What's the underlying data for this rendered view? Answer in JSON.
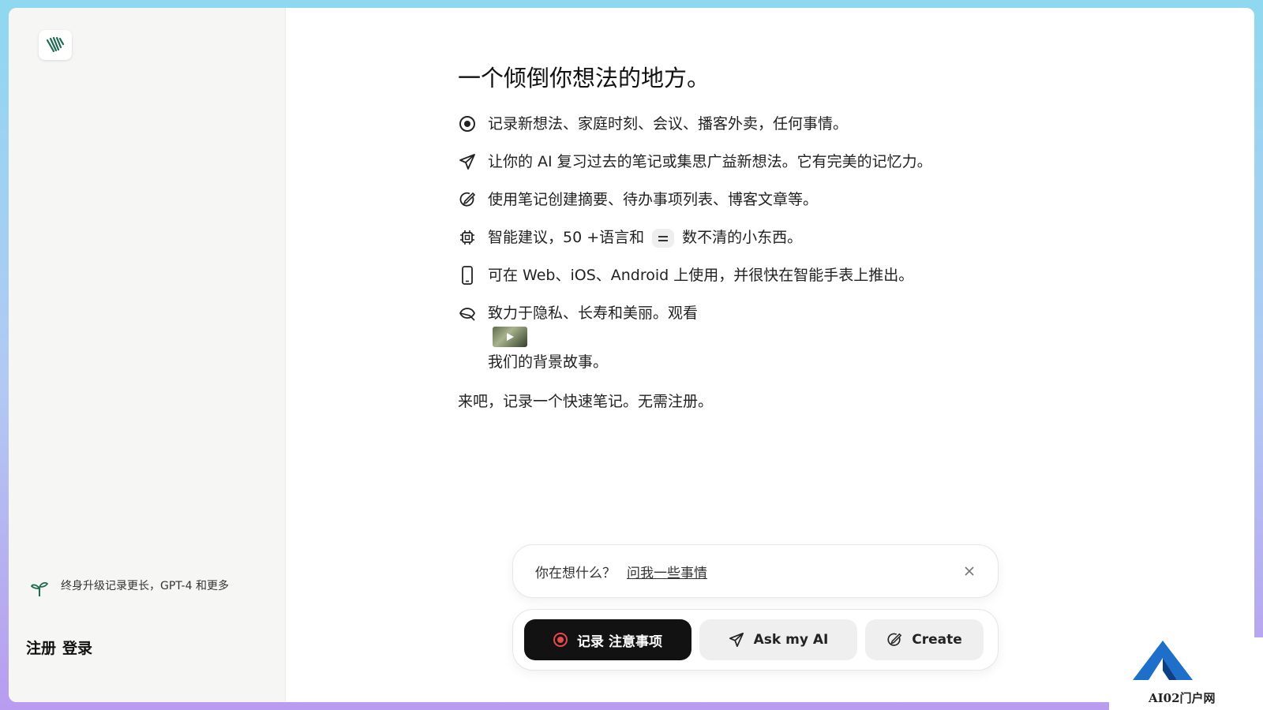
{
  "sidebar": {
    "upgrade_text": "终身升级记录更长，GPT-4 和更多",
    "signup": "注册",
    "login": "登录"
  },
  "main": {
    "headline": "一个倾倒你想法的地方。",
    "features": [
      {
        "icon": "record-target-icon",
        "text": "记录新想法、家庭时刻、会议、播客外卖，任何事情。"
      },
      {
        "icon": "send-icon",
        "text": "让你的 AI 复习过去的笔记或集思广益新想法。它有完美的记忆力。"
      },
      {
        "icon": "create-edit-icon",
        "text": "使用笔记创建摘要、待办事项列表、博客文章等。"
      },
      {
        "icon": "chip-icon",
        "text_a": "智能建议，50 +语言和",
        "text_b": "数不清的小东西。"
      },
      {
        "icon": "phone-icon",
        "text": "可在 Web、iOS、Android 上使用，并很快在智能手表上推出。"
      },
      {
        "icon": "leaf-icon",
        "text_a": "致力于隐私、长寿和美丽。观看",
        "text_b": "我们的背景故事。"
      }
    ],
    "closing": "来吧，记录一个快速笔记。无需注册。"
  },
  "ask_bar": {
    "question": "你在想什么？",
    "link": "问我一些事情"
  },
  "actions": {
    "record_label": "记录  注意事项",
    "ask_label": "Ask my AI",
    "create_label": "Create"
  },
  "watermark": {
    "text": "AI02门户网"
  },
  "colors": {
    "accent": "#121212",
    "record": "#e5484d",
    "brand_leaf": "#1f6b52"
  }
}
